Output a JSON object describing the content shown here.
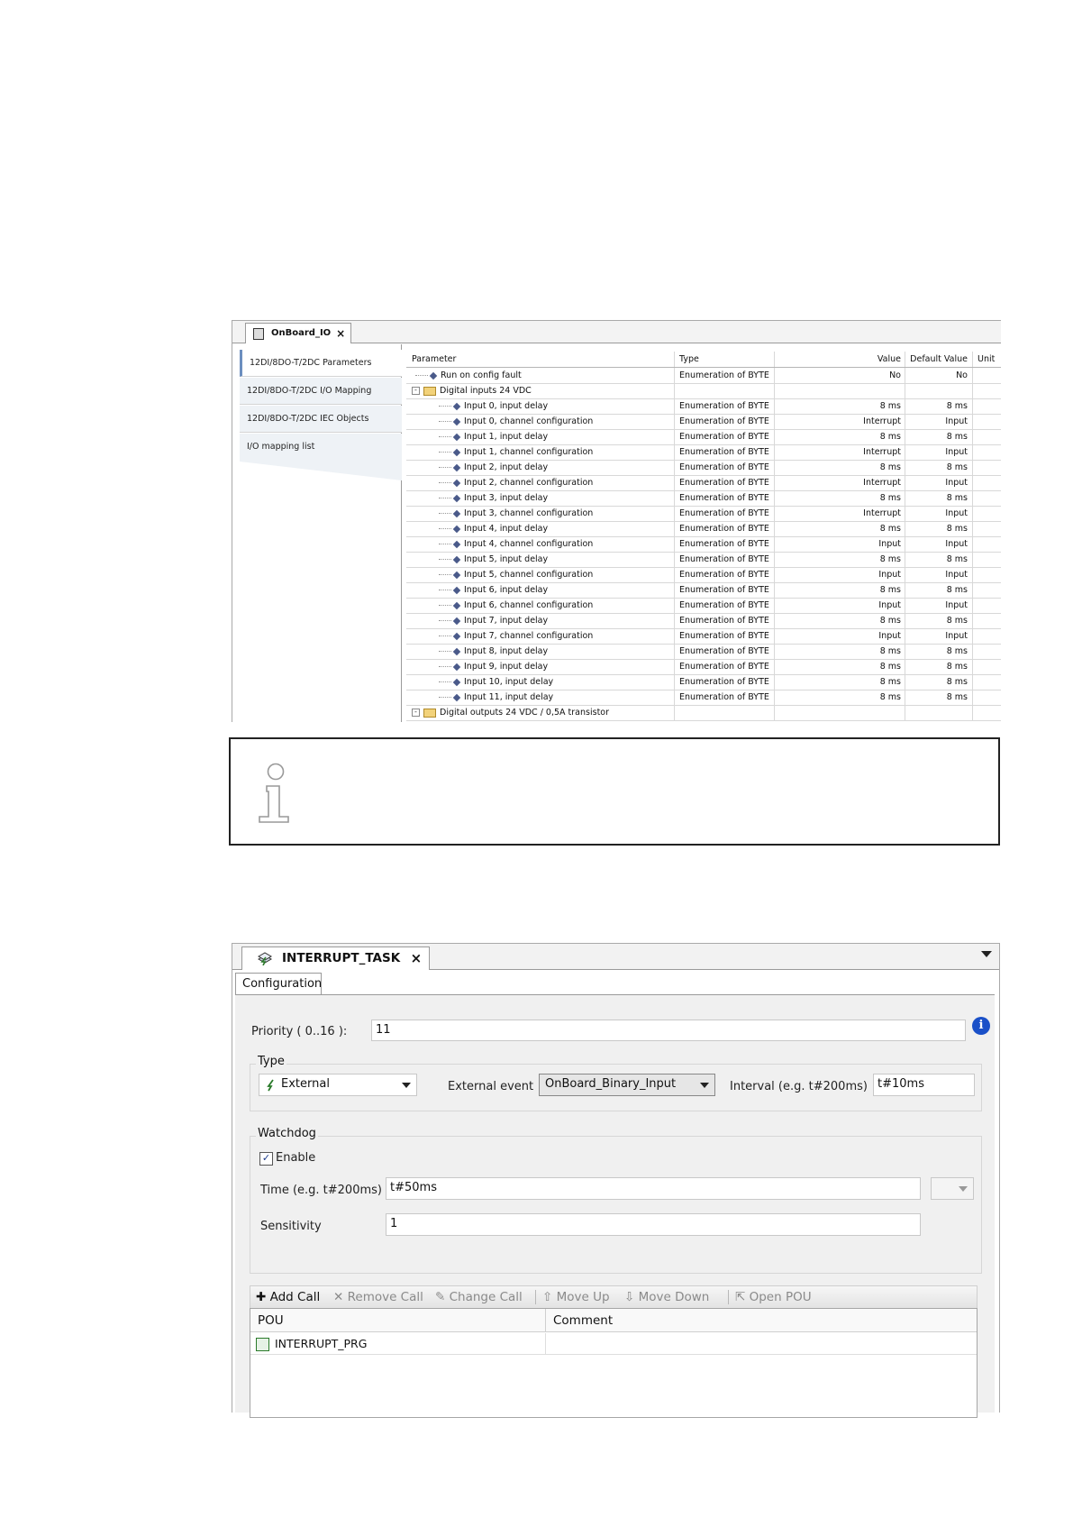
{
  "io_window": {
    "tab_title": "OnBoard_IO",
    "close_glyph": "×",
    "sidebar": [
      "12DI/8DO-T/2DC Parameters",
      "12DI/8DO-T/2DC I/O Mapping",
      "12DI/8DO-T/2DC IEC Objects",
      "I/O mapping list"
    ],
    "columns": [
      "Parameter",
      "Type",
      "Value",
      "Default Value",
      "Unit"
    ],
    "rows": [
      {
        "level": 1,
        "kind": "param",
        "parameter": "Run on config fault",
        "type": "Enumeration of BYTE",
        "value": "No",
        "default": "No"
      },
      {
        "level": 0,
        "kind": "folder",
        "parameter": "Digital inputs 24 VDC",
        "type": "",
        "value": "",
        "default": ""
      },
      {
        "level": 2,
        "kind": "param",
        "parameter": "Input 0, input delay",
        "type": "Enumeration of BYTE",
        "value": "8 ms",
        "default": "8 ms"
      },
      {
        "level": 2,
        "kind": "param",
        "parameter": "Input 0, channel configuration",
        "type": "Enumeration of BYTE",
        "value": "Interrupt",
        "default": "Input"
      },
      {
        "level": 2,
        "kind": "param",
        "parameter": "Input 1, input delay",
        "type": "Enumeration of BYTE",
        "value": "8 ms",
        "default": "8 ms"
      },
      {
        "level": 2,
        "kind": "param",
        "parameter": "Input 1, channel configuration",
        "type": "Enumeration of BYTE",
        "value": "Interrupt",
        "default": "Input"
      },
      {
        "level": 2,
        "kind": "param",
        "parameter": "Input 2, input delay",
        "type": "Enumeration of BYTE",
        "value": "8 ms",
        "default": "8 ms"
      },
      {
        "level": 2,
        "kind": "param",
        "parameter": "Input 2, channel configuration",
        "type": "Enumeration of BYTE",
        "value": "Interrupt",
        "default": "Input"
      },
      {
        "level": 2,
        "kind": "param",
        "parameter": "Input 3, input delay",
        "type": "Enumeration of BYTE",
        "value": "8 ms",
        "default": "8 ms"
      },
      {
        "level": 2,
        "kind": "param",
        "parameter": "Input 3, channel configuration",
        "type": "Enumeration of BYTE",
        "value": "Interrupt",
        "default": "Input"
      },
      {
        "level": 2,
        "kind": "param",
        "parameter": "Input 4, input delay",
        "type": "Enumeration of BYTE",
        "value": "8 ms",
        "default": "8 ms"
      },
      {
        "level": 2,
        "kind": "param",
        "parameter": "Input 4, channel configuration",
        "type": "Enumeration of BYTE",
        "value": "Input",
        "default": "Input"
      },
      {
        "level": 2,
        "kind": "param",
        "parameter": "Input 5, input delay",
        "type": "Enumeration of BYTE",
        "value": "8 ms",
        "default": "8 ms"
      },
      {
        "level": 2,
        "kind": "param",
        "parameter": "Input 5, channel configuration",
        "type": "Enumeration of BYTE",
        "value": "Input",
        "default": "Input"
      },
      {
        "level": 2,
        "kind": "param",
        "parameter": "Input 6, input delay",
        "type": "Enumeration of BYTE",
        "value": "8 ms",
        "default": "8 ms"
      },
      {
        "level": 2,
        "kind": "param",
        "parameter": "Input 6, channel configuration",
        "type": "Enumeration of BYTE",
        "value": "Input",
        "default": "Input"
      },
      {
        "level": 2,
        "kind": "param",
        "parameter": "Input 7, input delay",
        "type": "Enumeration of BYTE",
        "value": "8 ms",
        "default": "8 ms"
      },
      {
        "level": 2,
        "kind": "param",
        "parameter": "Input 7, channel configuration",
        "type": "Enumeration of BYTE",
        "value": "Input",
        "default": "Input"
      },
      {
        "level": 2,
        "kind": "param",
        "parameter": "Input 8, input delay",
        "type": "Enumeration of BYTE",
        "value": "8 ms",
        "default": "8 ms"
      },
      {
        "level": 2,
        "kind": "param",
        "parameter": "Input 9, input delay",
        "type": "Enumeration of BYTE",
        "value": "8 ms",
        "default": "8 ms"
      },
      {
        "level": 2,
        "kind": "param",
        "parameter": "Input 10, input delay",
        "type": "Enumeration of BYTE",
        "value": "8 ms",
        "default": "8 ms"
      },
      {
        "level": 2,
        "kind": "param",
        "parameter": "Input 11, input delay",
        "type": "Enumeration of BYTE",
        "value": "8 ms",
        "default": "8 ms"
      },
      {
        "level": 0,
        "kind": "folder",
        "parameter": "Digital outputs 24 VDC / 0,5A transistor",
        "type": "",
        "value": "",
        "default": ""
      }
    ]
  },
  "task_window": {
    "tab_title": "INTERRUPT_TASK",
    "close_glyph": "×",
    "config_tab": "Configuration",
    "priority_label": "Priority ( 0..16 ):",
    "priority_value": "11",
    "type_group": "Type",
    "type_value": "External",
    "external_event_label": "External event",
    "external_event_value": "OnBoard_Binary_Input",
    "interval_label": "Interval (e.g. t#200ms)",
    "interval_value": "t#10ms",
    "watchdog_group": "Watchdog",
    "enable_label": "Enable",
    "enable_checked": true,
    "time_label": "Time (e.g. t#200ms)",
    "time_value": "t#50ms",
    "sensitivity_label": "Sensitivity",
    "sensitivity_value": "1",
    "toolbar": {
      "add_call": "Add Call",
      "remove_call": "Remove Call",
      "change_call": "Change Call",
      "move_up": "Move Up",
      "move_down": "Move Down",
      "open_pou": "Open POU"
    },
    "calls_columns": [
      "POU",
      "Comment"
    ],
    "calls": [
      {
        "pou": "INTERRUPT_PRG",
        "comment": ""
      }
    ]
  },
  "icons": [
    "info-icon",
    "tab-task-icon",
    "external-event-icon",
    "add-icon",
    "remove-icon",
    "edit-icon",
    "up-icon",
    "down-icon",
    "open-icon",
    "pou-icon",
    "info-button-icon"
  ]
}
